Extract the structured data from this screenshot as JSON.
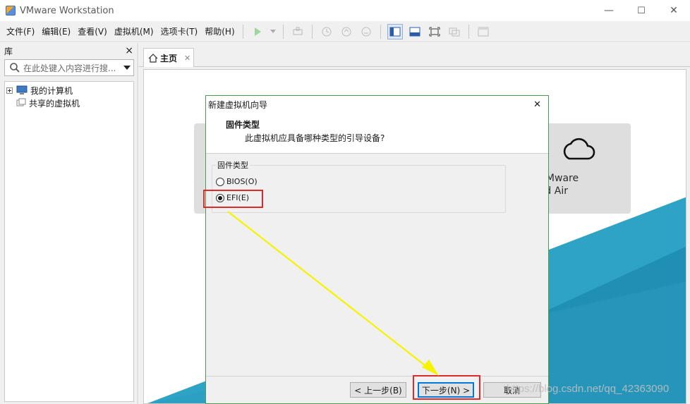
{
  "window": {
    "title": "VMware Workstation",
    "controls": {
      "minimize": "—",
      "maximize": "☐",
      "close": "✕"
    }
  },
  "menu": {
    "items": [
      "文件(F)",
      "编辑(E)",
      "查看(V)",
      "虚拟机(M)",
      "选项卡(T)",
      "帮助(H)"
    ]
  },
  "toolbar": {
    "icons": [
      "play-icon",
      "dropdown-icon",
      "send-keys-icon",
      "snapshot-icon",
      "revert-snapshot-icon",
      "manage-snapshots-icon",
      "library-view-icon",
      "thumbnail-bar-icon",
      "fullscreen-icon",
      "unity-icon",
      "console-view-icon"
    ]
  },
  "library": {
    "title": "库",
    "close": "×",
    "search_placeholder": "在此处键入内容进行搜...",
    "tree": [
      "我的计算机",
      "共享的虚拟机"
    ]
  },
  "tabs": {
    "home": {
      "label": "主页",
      "close": "✕"
    }
  },
  "home": {
    "cloud_card": {
      "line1": "连接到 VMware",
      "line2": "vCloud Air"
    }
  },
  "dialog": {
    "title": "新建虚拟机向导",
    "close": "✕",
    "heading": "固件类型",
    "subheading": "此虚拟机应具备哪种类型的引导设备?",
    "group_label": "固件类型",
    "options": [
      {
        "label": "BIOS(O)",
        "selected": false
      },
      {
        "label": "EFI(E)",
        "selected": true
      }
    ],
    "buttons": {
      "back": "< 上一步(B)",
      "next": "下一步(N) >",
      "cancel": "取消"
    }
  },
  "watermark": "https://blog.csdn.net/qq_42363090",
  "colors": {
    "accent": "#0078d7",
    "annotation_red": "#e02a2a",
    "annotation_yellow": "#f4f400",
    "teal": "#2fa3c6",
    "dialog_border": "#4c9a4c"
  }
}
